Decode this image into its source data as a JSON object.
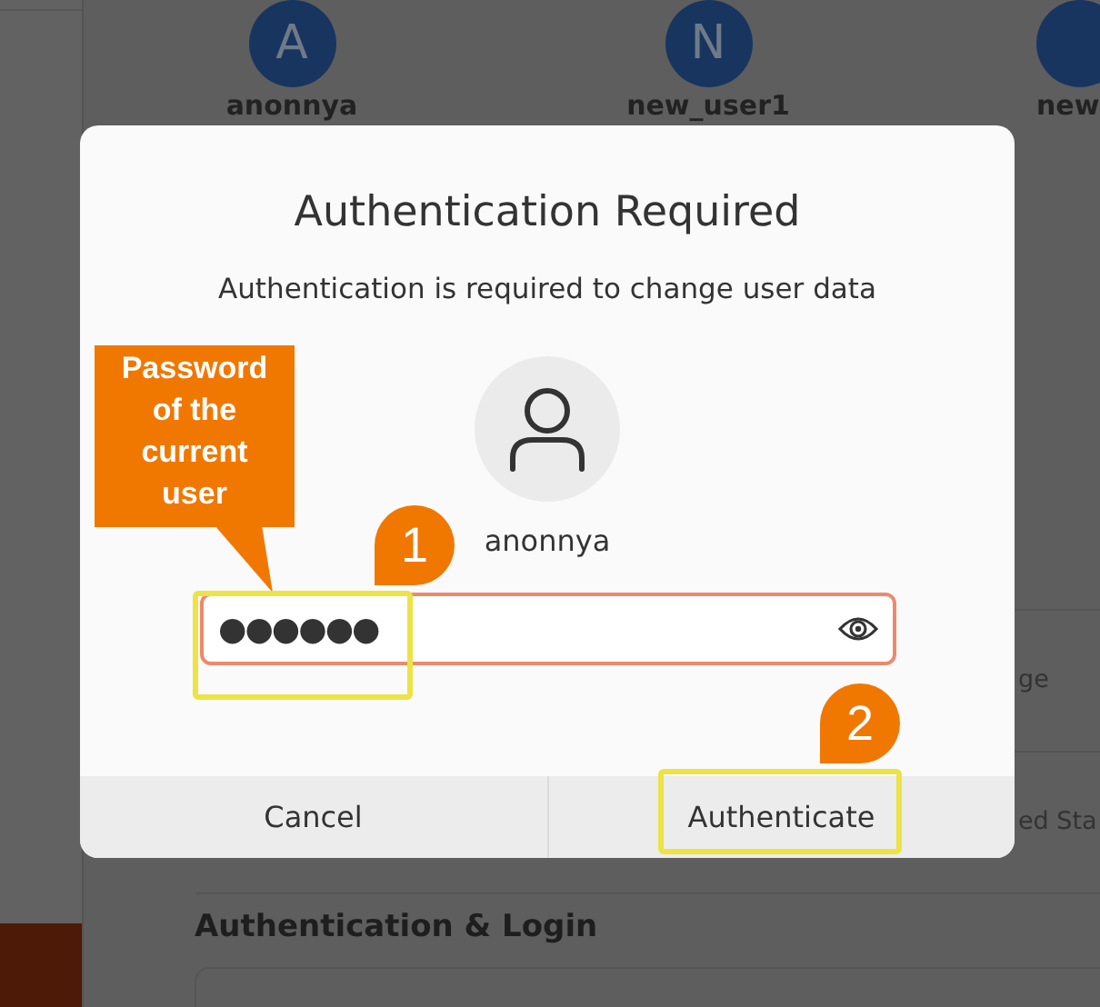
{
  "background": {
    "users": [
      {
        "initial": "A",
        "name": "anonnya"
      },
      {
        "initial": "N",
        "name": "new_user1"
      },
      {
        "name": "new"
      }
    ],
    "rows": [
      "ge",
      "ed Sta"
    ],
    "section_title": "Authentication & Login"
  },
  "dialog": {
    "title": "Authentication Required",
    "message": "Authentication is required to change user data",
    "user": "anonnya",
    "password": {
      "value": "●●●●●●"
    },
    "buttons": [
      "Cancel",
      "Authenticate"
    ]
  },
  "annotations": [
    {
      "kind": "callout",
      "text": "Password of the current user"
    },
    {
      "kind": "frame"
    },
    {
      "kind": "badge",
      "text": "1"
    },
    {
      "kind": "frame"
    },
    {
      "kind": "badge",
      "text": "2"
    }
  ]
}
